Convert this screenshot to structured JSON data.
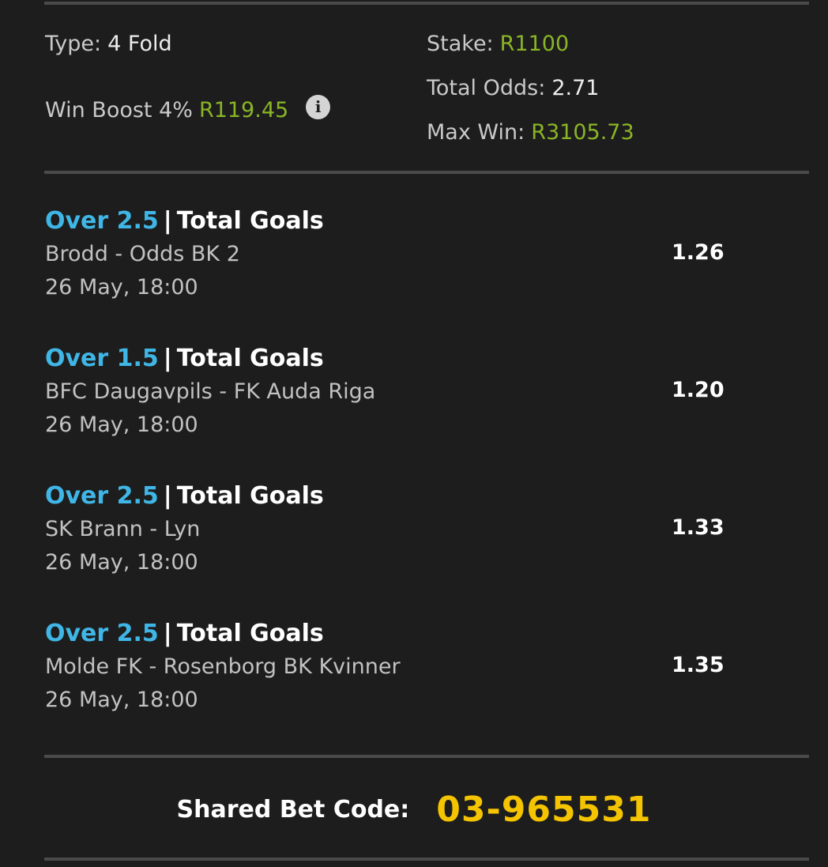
{
  "summary": {
    "type_label": "Type:",
    "type_value": "4 Fold",
    "boost_label": "Win Boost 4%",
    "boost_value": "R119.45",
    "stake_label": "Stake:",
    "stake_value": "R1100",
    "odds_label": "Total Odds:",
    "odds_value": "2.71",
    "maxwin_label": "Max Win:",
    "maxwin_value": "R3105.73"
  },
  "selections": [
    {
      "pick": "Over 2.5",
      "sep": "|",
      "market": "Total Goals",
      "match": "Brodd - Odds BK 2",
      "date": "26 May, 18:00",
      "odds": "1.26"
    },
    {
      "pick": "Over 1.5",
      "sep": "|",
      "market": "Total Goals",
      "match": "BFC Daugavpils - FK Auda Riga",
      "date": "26 May, 18:00",
      "odds": "1.20"
    },
    {
      "pick": "Over 2.5",
      "sep": "|",
      "market": "Total Goals",
      "match": "SK Brann - Lyn",
      "date": "26 May, 18:00",
      "odds": "1.33"
    },
    {
      "pick": "Over 2.5",
      "sep": "|",
      "market": "Total Goals",
      "match": "Molde FK - Rosenborg BK Kvinner",
      "date": "26 May, 18:00",
      "odds": "1.35"
    }
  ],
  "footer": {
    "code_label": "Shared Bet Code:",
    "code_value": "03-965531"
  },
  "icons": {
    "info": "info-icon"
  },
  "colors": {
    "background": "#1d1d1d",
    "green_value": "#8ab526",
    "pick_blue": "#3fb6e6",
    "code_yellow": "#f5c400"
  }
}
